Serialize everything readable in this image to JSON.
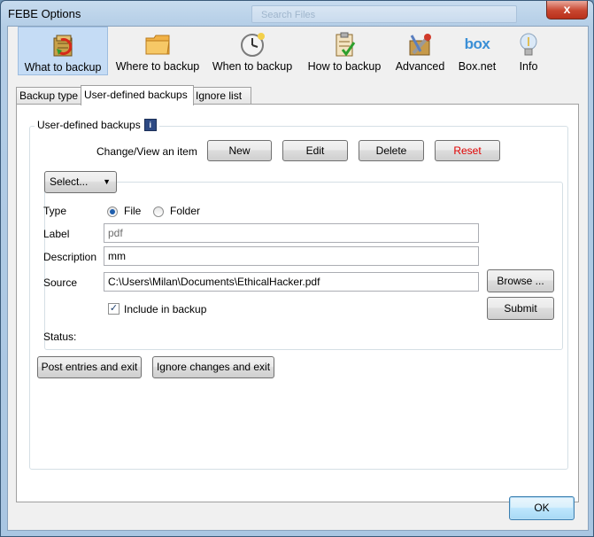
{
  "window": {
    "title": "FEBE Options",
    "search_placeholder": "Search Files",
    "close_glyph": "x"
  },
  "toolbar": {
    "items": [
      {
        "label": "What to backup",
        "icon": "books-refresh-icon",
        "active": true
      },
      {
        "label": "Where to backup",
        "icon": "folder-icon",
        "active": false
      },
      {
        "label": "When to backup",
        "icon": "clock-icon",
        "active": false
      },
      {
        "label": "How to backup",
        "icon": "clipboard-check-icon",
        "active": false
      },
      {
        "label": "Advanced",
        "icon": "tools-icon",
        "active": false
      },
      {
        "label": "Box.net",
        "icon": "box-logo-icon",
        "active": false
      },
      {
        "label": "Info",
        "icon": "lightbulb-icon",
        "active": false
      }
    ],
    "box_logo_text": "box"
  },
  "tabs": [
    {
      "label": "Backup type",
      "active": false
    },
    {
      "label": "User-defined backups",
      "active": true
    },
    {
      "label": "Ignore list",
      "active": false
    }
  ],
  "group": {
    "legend": "User-defined backups",
    "info_glyph": "i",
    "change_view_label": "Change/View an item",
    "buttons": {
      "new": "New",
      "edit": "Edit",
      "delete": "Delete",
      "reset": "Reset"
    },
    "reset_color": "#e00000",
    "select_label": "Select...",
    "type_label": "Type",
    "type_options": [
      {
        "label": "File",
        "selected": true
      },
      {
        "label": "Folder",
        "selected": false
      }
    ],
    "label_label": "Label",
    "label_value": "pdf",
    "description_label": "Description",
    "description_value": "mm",
    "source_label": "Source",
    "source_value": "C:\\Users\\Milan\\Documents\\EthicalHacker.pdf",
    "browse_label": "Browse ...",
    "include_label": "Include in backup",
    "include_checked": true,
    "submit_label": "Submit",
    "status_label": "Status:"
  },
  "footer_buttons": {
    "post": "Post entries and exit",
    "ignore": "Ignore changes and exit"
  },
  "ok_label": "OK"
}
